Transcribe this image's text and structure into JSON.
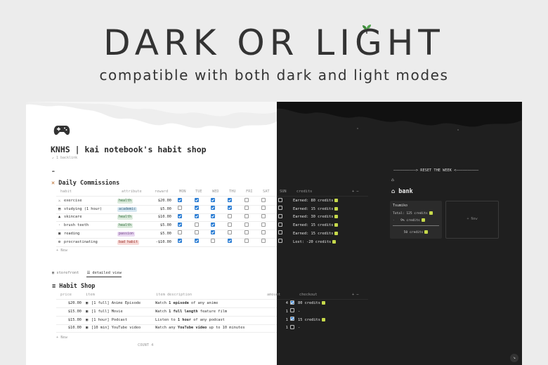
{
  "hero": {
    "title": "DARK OR LIGHT",
    "subtitle": "compatible with both dark and light modes"
  },
  "page": {
    "icon": "gamepad-icon",
    "title": "KNHS | kai notebook's habit shop",
    "backlink": "↙ 1 backlink",
    "pin_icon": "pushpin-icon"
  },
  "daily": {
    "title": "Daily Commissions",
    "title_icon": "crossed-swords-icon",
    "columns": [
      "habit",
      "attribute",
      "reward",
      "MON",
      "TUE",
      "WED",
      "THU",
      "FRI",
      "SAT",
      "SUN",
      "credits"
    ],
    "rows": [
      {
        "icon": "⚔",
        "habit": "exercise",
        "attribute": "health",
        "tag": "green",
        "reward": "$20.00",
        "days": [
          true,
          true,
          true,
          true,
          false,
          false,
          false
        ],
        "credits": "Earned: 80 credits"
      },
      {
        "icon": "▤",
        "habit": "studying (1 hour)",
        "attribute": "academic",
        "tag": "blue",
        "reward": "$5.00",
        "days": [
          false,
          true,
          true,
          true,
          false,
          false,
          false
        ],
        "credits": "Earned: 15 credits"
      },
      {
        "icon": "▲",
        "habit": "skincare",
        "attribute": "health",
        "tag": "green",
        "reward": "$10.00",
        "days": [
          true,
          true,
          true,
          false,
          false,
          false,
          false
        ],
        "credits": "Earned: 30 credits"
      },
      {
        "icon": "·",
        "habit": "brush teeth",
        "attribute": "health",
        "tag": "green",
        "reward": "$5.00",
        "days": [
          true,
          false,
          true,
          false,
          false,
          false,
          false
        ],
        "credits": "Earned: 15 credits"
      },
      {
        "icon": "▣",
        "habit": "reading",
        "attribute": "passion",
        "tag": "purple",
        "reward": "$5.00",
        "days": [
          false,
          false,
          true,
          false,
          false,
          false,
          false
        ],
        "credits": "Earned: 15 credits"
      },
      {
        "icon": "⚙",
        "habit": "procrastinating",
        "attribute": "bad habit",
        "tag": "red",
        "reward": "-$10.00",
        "days": [
          true,
          true,
          false,
          true,
          false,
          false,
          false
        ],
        "credits": "Lost: -20 credits"
      }
    ],
    "new_label": "+ New"
  },
  "tabs": [
    {
      "label": "▦ storefront",
      "active": false
    },
    {
      "label": "☰ detailed view",
      "active": true
    }
  ],
  "shop": {
    "title": "Habit Shop",
    "columns": [
      "price",
      "item",
      "item description",
      "amount",
      "checkout"
    ],
    "rows": [
      {
        "price": "$20.00",
        "item": "[1 full] Anime Episode",
        "desc_pre": "Watch ",
        "desc_bold": "1 episode",
        "desc_post": " of any anime",
        "amount": "4",
        "checked": true,
        "checkout": "80 credits"
      },
      {
        "price": "$15.00",
        "item": "[1 full] Movie",
        "desc_pre": "Watch ",
        "desc_bold": "1 full length",
        "desc_post": " feature film",
        "amount": "1",
        "checked": false,
        "checkout": "-"
      },
      {
        "price": "$15.00",
        "item": "[1 hour] Podcast",
        "desc_pre": "Listen to ",
        "desc_bold": "1 hour",
        "desc_post": " of any podcast",
        "amount": "1",
        "checked": true,
        "checkout": "15 credits"
      },
      {
        "price": "$10.00",
        "item": "[10 min] YouTube video",
        "desc_pre": "Watch any ",
        "desc_bold": "YouTube video",
        "desc_post": " up to 10 minutes",
        "amount": "1",
        "checked": false,
        "checkout": "-"
      }
    ],
    "new_label": "+ New",
    "count_label": "COUNT 4"
  },
  "bank": {
    "reset_label": "——————————> RESET THE WEEK <——————————",
    "title": "bank",
    "card_title": "Tsumiko",
    "total": "Total: 125 credits",
    "percent": "9% credits",
    "amount": "50 credits",
    "new_label": "+ New"
  },
  "colors": {
    "light_bg": "#ffffff",
    "dark_bg": "#1f1f1f",
    "checkbox": "#2f80d5",
    "coin": "#c6d94a"
  }
}
